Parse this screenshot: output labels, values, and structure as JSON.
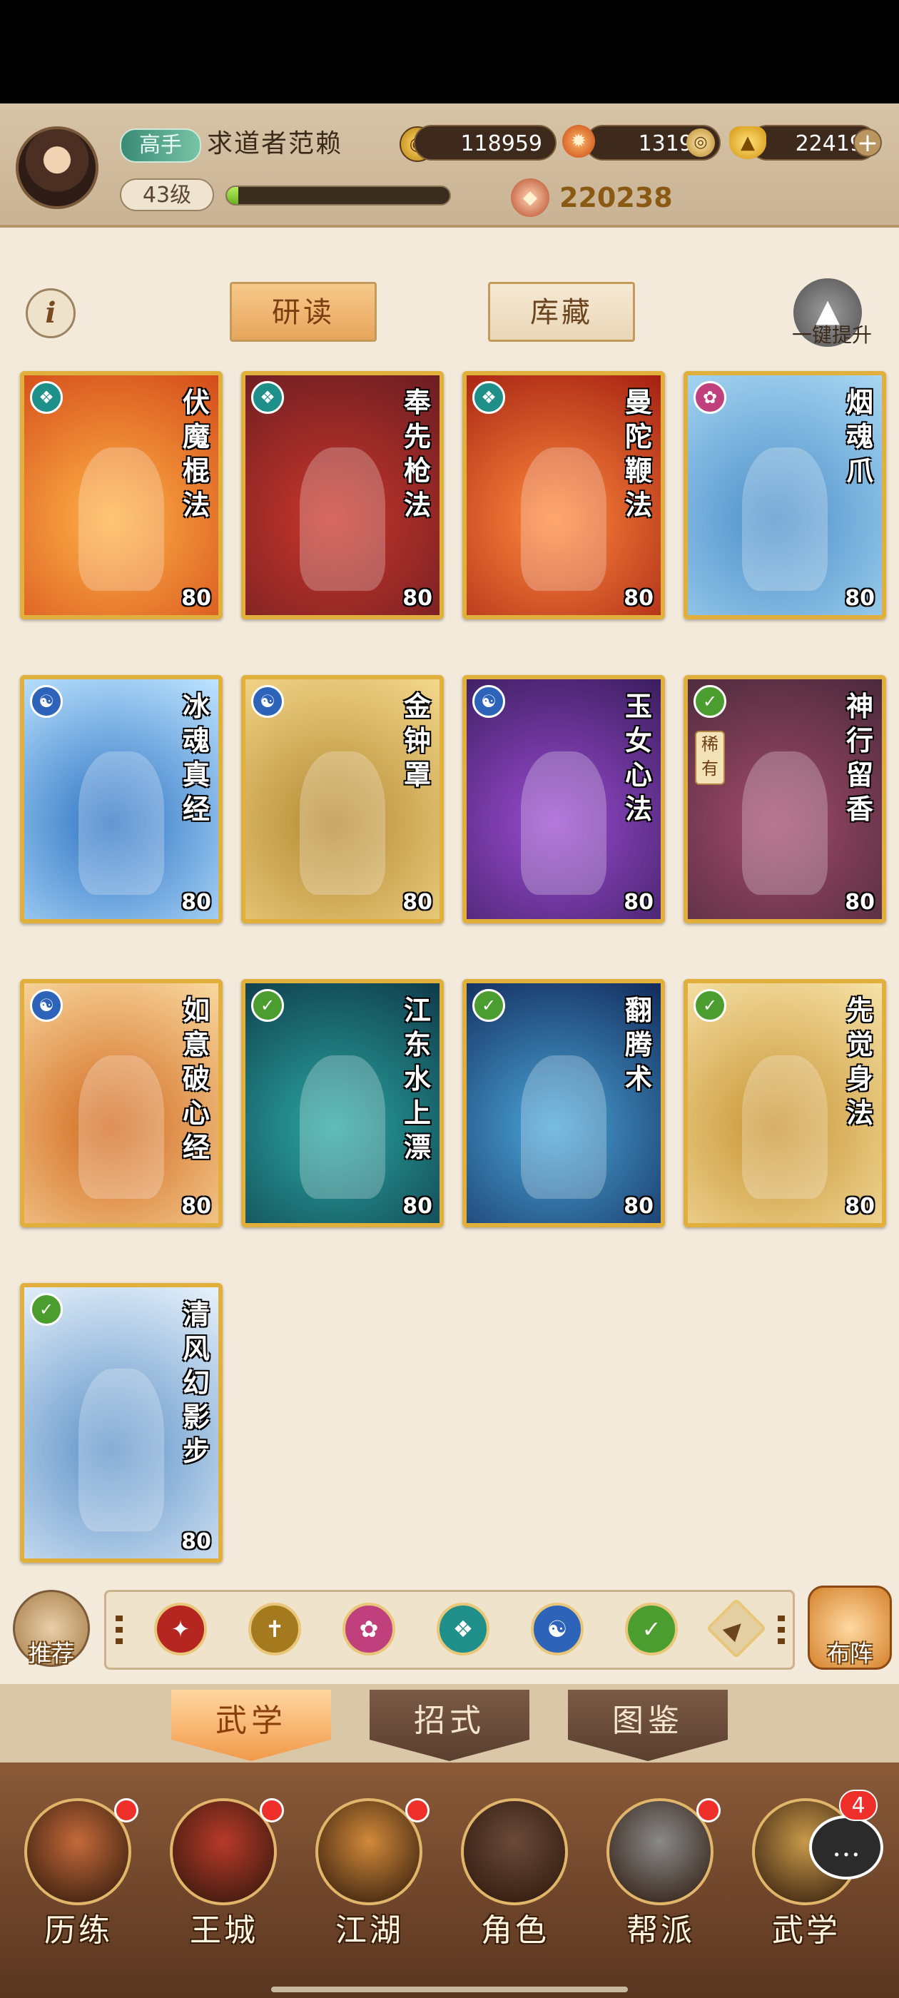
{
  "header": {
    "rank": "高手",
    "player_name": "求道者范赖",
    "level": "43级",
    "exp_fraction": 0.05,
    "power": "220238",
    "currencies": {
      "coins": "118959",
      "fire": "13198",
      "gold": "22419"
    }
  },
  "tabs": {
    "research": "研读",
    "storage": "库藏",
    "upgrade": "一键提升"
  },
  "cards": [
    {
      "title": "伏魔棍法",
      "level": "80",
      "type": "teal",
      "colors": [
        "#d34b1a",
        "#ffb347"
      ]
    },
    {
      "title": "奉先枪法",
      "level": "80",
      "type": "teal",
      "colors": [
        "#6a1d22",
        "#c9362b"
      ]
    },
    {
      "title": "曼陀鞭法",
      "level": "80",
      "type": "teal",
      "colors": [
        "#a42012",
        "#ff8a3d"
      ]
    },
    {
      "title": "烟魂爪",
      "level": "80",
      "type": "pink",
      "colors": [
        "#a9d7f2",
        "#4d8fc9"
      ]
    },
    {
      "title": "冰魂真经",
      "level": "80",
      "type": "blue",
      "colors": [
        "#bfe5ff",
        "#2f74c4"
      ]
    },
    {
      "title": "金钟罩",
      "level": "80",
      "type": "blue",
      "colors": [
        "#f3d88c",
        "#b58a33"
      ]
    },
    {
      "title": "玉女心法",
      "level": "80",
      "type": "blue",
      "colors": [
        "#3a1e5e",
        "#9a4bd0"
      ]
    },
    {
      "title": "神行留香",
      "level": "80",
      "type": "green",
      "colors": [
        "#4a2a3a",
        "#a24a6a"
      ],
      "rare": "稀有"
    },
    {
      "title": "如意破心经",
      "level": "80",
      "type": "blue",
      "colors": [
        "#f9d9a0",
        "#d26a20"
      ]
    },
    {
      "title": "江东水上漂",
      "level": "80",
      "type": "green",
      "colors": [
        "#0f3a4a",
        "#2aa7a0"
      ]
    },
    {
      "title": "翻腾术",
      "level": "80",
      "type": "green",
      "colors": [
        "#122a5a",
        "#4aa6d8"
      ]
    },
    {
      "title": "先觉身法",
      "level": "80",
      "type": "green",
      "colors": [
        "#f6e2a8",
        "#c99534"
      ]
    },
    {
      "title": "清风幻影步",
      "level": "80",
      "type": "green",
      "colors": [
        "#e8f2fb",
        "#5f93c8"
      ]
    }
  ],
  "filter": {
    "recommend": "推荐",
    "formation": "布阵",
    "icons": [
      "red-blade",
      "bronze-sword",
      "pink-claw",
      "teal-fan",
      "blue-yin-yang",
      "green-swirl",
      "up-arrow"
    ]
  },
  "subtabs": [
    "武学",
    "招式",
    "图鉴"
  ],
  "bottom_nav": [
    {
      "label": "历练",
      "dot": true
    },
    {
      "label": "王城",
      "dot": true
    },
    {
      "label": "江湖",
      "dot": true
    },
    {
      "label": "角色",
      "dot": false
    },
    {
      "label": "帮派",
      "dot": true
    },
    {
      "label": "武学",
      "dot": false
    }
  ],
  "chat_badge": "4"
}
